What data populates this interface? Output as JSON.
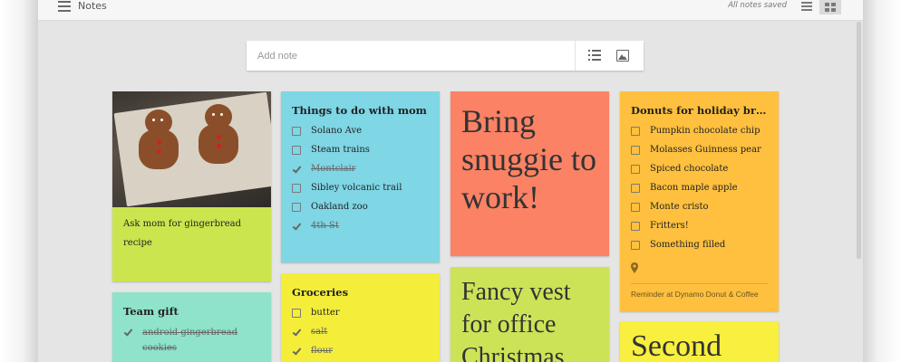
{
  "app": {
    "title": "Notes",
    "status": "All notes saved"
  },
  "icons": {
    "menu": "menu-icon",
    "list_view": "list-view-icon",
    "grid_view": "grid-view-icon",
    "new_list": "new-list-icon",
    "new_image": "image-icon",
    "location": "location-pin-icon",
    "check": "check-icon",
    "checkbox": "checkbox-icon"
  },
  "add_note": {
    "placeholder": "Add note"
  },
  "colors": {
    "green": "#cbe54e",
    "cyan": "#7fd6e5",
    "salmon": "#fb8265",
    "orange": "#fec03e",
    "teal": "#8ee3ca",
    "yellow": "#f4ee3b",
    "lime": "#cde357",
    "light_yellow": "#f8ef3e"
  },
  "notes": {
    "gingerbread": {
      "text": "Ask mom for gingerbread recipe"
    },
    "mom": {
      "title": "Things to do with mom",
      "items": [
        {
          "text": "Solano Ave",
          "done": false
        },
        {
          "text": "Steam trains",
          "done": false
        },
        {
          "text": "Montclair",
          "done": true
        },
        {
          "text": "Sibley volcanic trail",
          "done": false
        },
        {
          "text": "Oakland zoo",
          "done": false
        },
        {
          "text": "4th St",
          "done": true
        }
      ]
    },
    "snuggie": {
      "text": "Bring snuggie to work!"
    },
    "donuts": {
      "title": "Donuts for holiday brun…",
      "items": [
        {
          "text": "Pumpkin chocolate chip",
          "done": false
        },
        {
          "text": "Molasses Guinness pear",
          "done": false
        },
        {
          "text": "Spiced chocolate",
          "done": false
        },
        {
          "text": "Bacon maple apple",
          "done": false
        },
        {
          "text": "Monte cristo",
          "done": false
        },
        {
          "text": "Fritters!",
          "done": false
        },
        {
          "text": "Something filled",
          "done": false
        }
      ],
      "reminder": "Reminder at Dynamo Donut & Coffee"
    },
    "team_gift": {
      "title": "Team gift",
      "items": [
        {
          "text": "android gingerbread cookies",
          "done": true
        }
      ]
    },
    "groceries": {
      "title": "Groceries",
      "items": [
        {
          "text": "butter",
          "done": false
        },
        {
          "text": "salt",
          "done": true
        },
        {
          "text": "flour",
          "done": true
        }
      ]
    },
    "vest": {
      "text": "Fancy vest for office Christmas"
    },
    "second": {
      "text": "Second"
    }
  }
}
